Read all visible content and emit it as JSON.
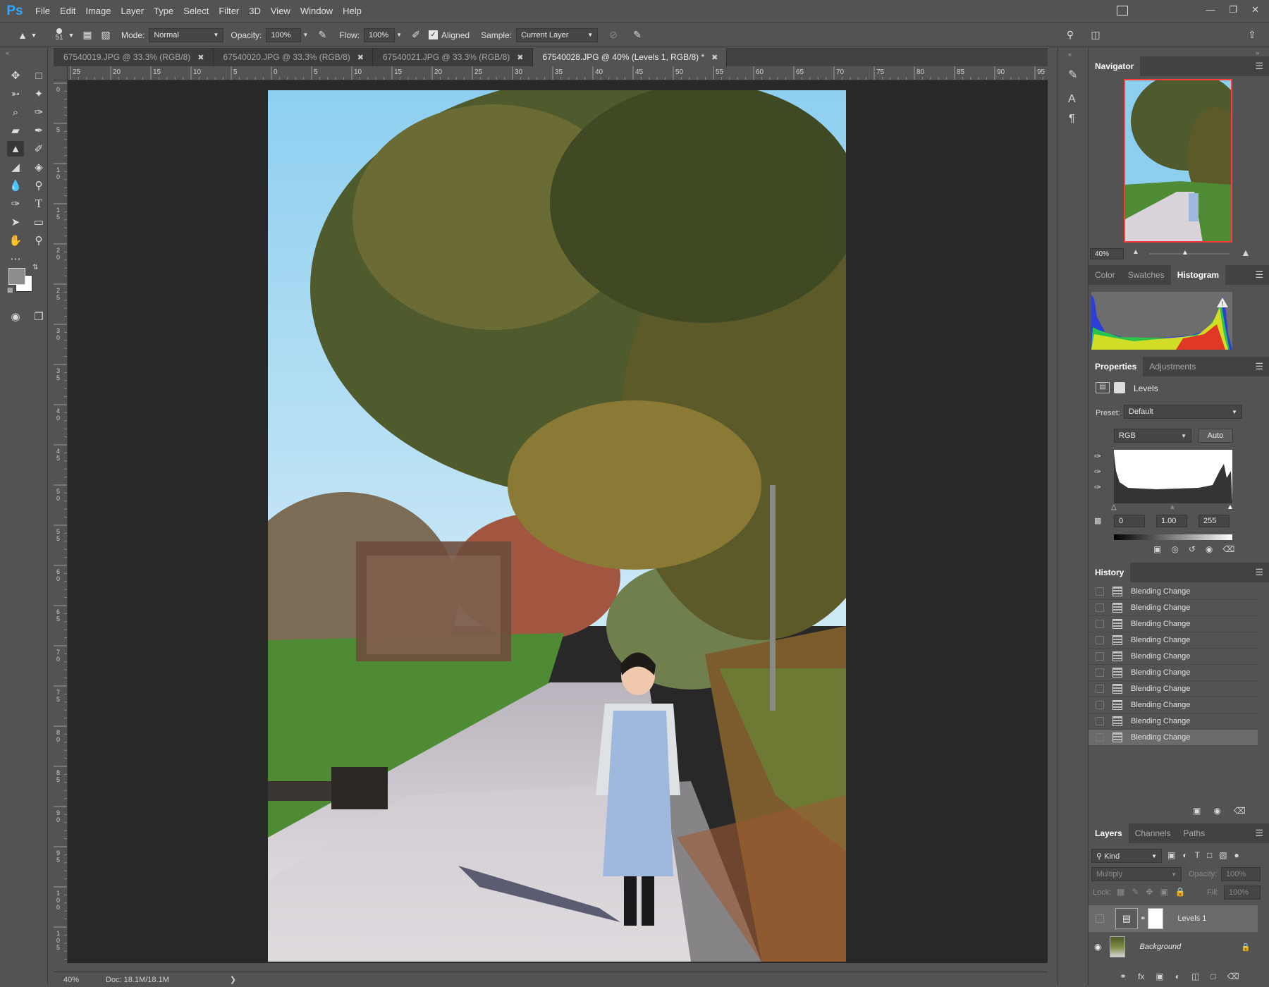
{
  "app": {
    "logo": "Ps"
  },
  "menu": [
    "File",
    "Edit",
    "Image",
    "Layer",
    "Type",
    "Select",
    "Filter",
    "3D",
    "View",
    "Window",
    "Help"
  ],
  "options_bar": {
    "brush_size": "51",
    "mode_label": "Mode:",
    "mode_value": "Normal",
    "opacity_label": "Opacity:",
    "opacity_value": "100%",
    "flow_label": "Flow:",
    "flow_value": "100%",
    "aligned_label": "Aligned",
    "sample_label": "Sample:",
    "sample_value": "Current Layer"
  },
  "tabs": [
    {
      "label": "67540019.JPG @ 33.3% (RGB/8)"
    },
    {
      "label": "67540020.JPG @ 33.3% (RGB/8)"
    },
    {
      "label": "67540021.JPG @ 33.3% (RGB/8)"
    },
    {
      "label": "67540028.JPG @ 40% (Levels 1, RGB/8) *",
      "active": true
    }
  ],
  "ruler_top": [
    "25",
    "20",
    "15",
    "10",
    "5",
    "0",
    "5",
    "10",
    "15",
    "20",
    "25",
    "30",
    "35",
    "40",
    "45",
    "50",
    "55",
    "60",
    "65",
    "70",
    "75",
    "80",
    "85",
    "90",
    "95"
  ],
  "ruler_left": [
    "0",
    "5",
    "10",
    "15",
    "20",
    "25",
    "30",
    "35",
    "40",
    "45",
    "50",
    "55",
    "60",
    "65",
    "70",
    "75",
    "80",
    "85",
    "90",
    "95",
    "100",
    "105"
  ],
  "status": {
    "zoom": "40%",
    "doc": "Doc: 18.1M/18.1M"
  },
  "navigator": {
    "title": "Navigator",
    "zoom": "40%"
  },
  "color_tabs": [
    "Color",
    "Swatches",
    "Histogram"
  ],
  "properties": {
    "tabs": [
      "Properties",
      "Adjustments"
    ],
    "title": "Levels",
    "preset_label": "Preset:",
    "preset_value": "Default",
    "channel": "RGB",
    "auto_label": "Auto",
    "input_black": "0",
    "input_gamma": "1.00",
    "input_white": "255"
  },
  "history": {
    "title": "History",
    "items": [
      "Blending Change",
      "Blending Change",
      "Blending Change",
      "Blending Change",
      "Blending Change",
      "Blending Change",
      "Blending Change",
      "Blending Change",
      "Blending Change",
      "Blending Change"
    ]
  },
  "layers": {
    "tabs": [
      "Layers",
      "Channels",
      "Paths"
    ],
    "filter_kind": "Kind",
    "blend_mode": "Multiply",
    "opacity_label": "Opacity:",
    "opacity_value": "100%",
    "lock_label": "Lock:",
    "fill_label": "Fill:",
    "fill_value": "100%",
    "items": [
      {
        "name": "Levels 1"
      },
      {
        "name": "Background"
      }
    ]
  },
  "colors": {
    "accent": "#31a8ff",
    "panel_bg": "#535353",
    "canvas_bg": "#282828",
    "nav_frame": "#ff3b3b"
  }
}
